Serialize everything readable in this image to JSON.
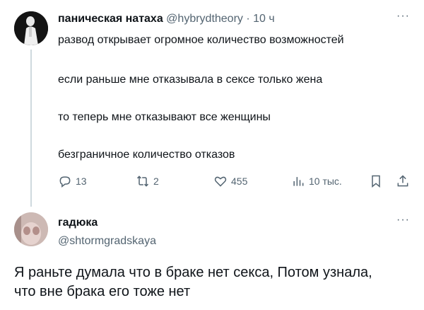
{
  "tweet": {
    "author_name": "паническая натаха",
    "handle": "@hybrydtheory",
    "separator": "·",
    "time": "10 ч",
    "more_label": "···",
    "lines": [
      "развод открывает огромное количество возможностей",
      "если раньше мне отказывала в сексе только жена",
      "то теперь мне отказывают все женщины",
      "безграничное количество отказов"
    ],
    "actions": {
      "replies": "13",
      "retweets": "2",
      "likes": "455",
      "views": "10 тыс."
    }
  },
  "reply": {
    "author_name": "гадюка",
    "handle": "@shtormgradskaya",
    "more_label": "···",
    "lines": [
      "Я раньте думала что в браке нет секса, Потом узнала,",
      "что вне брака его тоже нет"
    ]
  }
}
